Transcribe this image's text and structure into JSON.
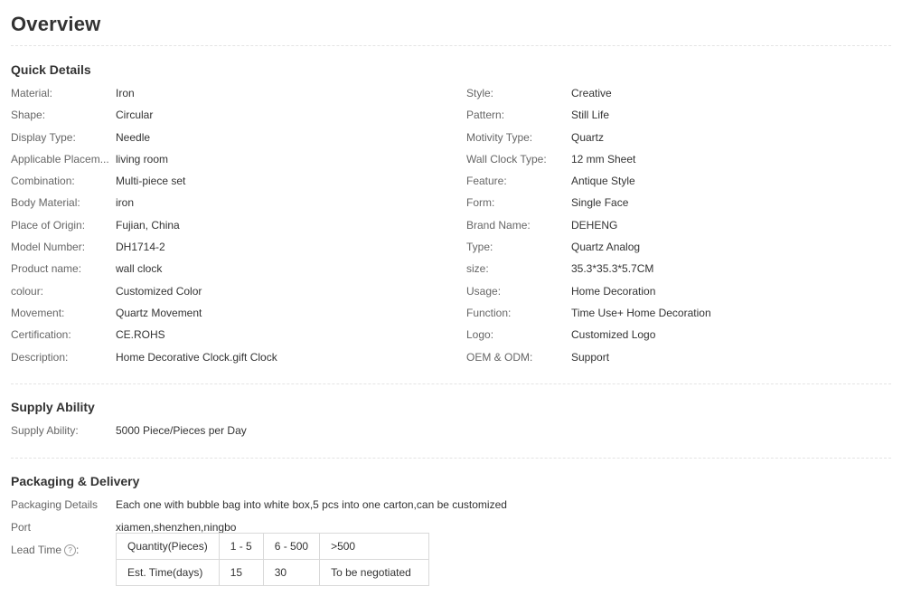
{
  "page_title": "Overview",
  "quick_details": {
    "title": "Quick Details",
    "left": [
      {
        "key": "Material:",
        "value": "Iron"
      },
      {
        "key": "Shape:",
        "value": "Circular"
      },
      {
        "key": "Display Type:",
        "value": "Needle"
      },
      {
        "key": "Applicable Placem...",
        "value": "living room"
      },
      {
        "key": "Combination:",
        "value": "Multi-piece set"
      },
      {
        "key": "Body Material:",
        "value": "iron"
      },
      {
        "key": "Place of Origin:",
        "value": "Fujian, China"
      },
      {
        "key": "Model Number:",
        "value": "DH1714-2"
      },
      {
        "key": "Product name:",
        "value": "wall clock"
      },
      {
        "key": "colour:",
        "value": "Customized Color"
      },
      {
        "key": "Movement:",
        "value": "Quartz Movement"
      },
      {
        "key": "Certification:",
        "value": "CE.ROHS"
      },
      {
        "key": "Description:",
        "value": "Home Decorative Clock.gift Clock"
      }
    ],
    "right": [
      {
        "key": "Style:",
        "value": "Creative"
      },
      {
        "key": "Pattern:",
        "value": "Still Life"
      },
      {
        "key": "Motivity Type:",
        "value": "Quartz"
      },
      {
        "key": "Wall Clock Type:",
        "value": "12 mm Sheet"
      },
      {
        "key": "Feature:",
        "value": "Antique Style"
      },
      {
        "key": "Form:",
        "value": "Single Face"
      },
      {
        "key": "Brand Name:",
        "value": "DEHENG"
      },
      {
        "key": "Type:",
        "value": "Quartz Analog"
      },
      {
        "key": "size:",
        "value": "35.3*35.3*5.7CM"
      },
      {
        "key": "Usage:",
        "value": "Home Decoration"
      },
      {
        "key": "Function:",
        "value": "Time Use+ Home Decoration"
      },
      {
        "key": "Logo:",
        "value": "Customized Logo"
      },
      {
        "key": "OEM & ODM:",
        "value": "Support"
      }
    ]
  },
  "supply_ability": {
    "title": "Supply Ability",
    "key": "Supply Ability:",
    "value": "5000 Piece/Pieces per Day"
  },
  "packaging": {
    "title": "Packaging & Delivery",
    "details_key": "Packaging Details",
    "details_value": "Each one with bubble bag into white box,5 pcs into one carton,can be customized",
    "port_key": "Port",
    "port_value": "xiamen,shenzhen,ningbo",
    "lead_time_key": "Lead Time",
    "help_icon_glyph": "?",
    "lead_table": {
      "row1": [
        "Quantity(Pieces)",
        "1 - 5",
        "6 - 500",
        ">500"
      ],
      "row2": [
        "Est. Time(days)",
        "15",
        "30",
        "To be negotiated"
      ]
    }
  }
}
